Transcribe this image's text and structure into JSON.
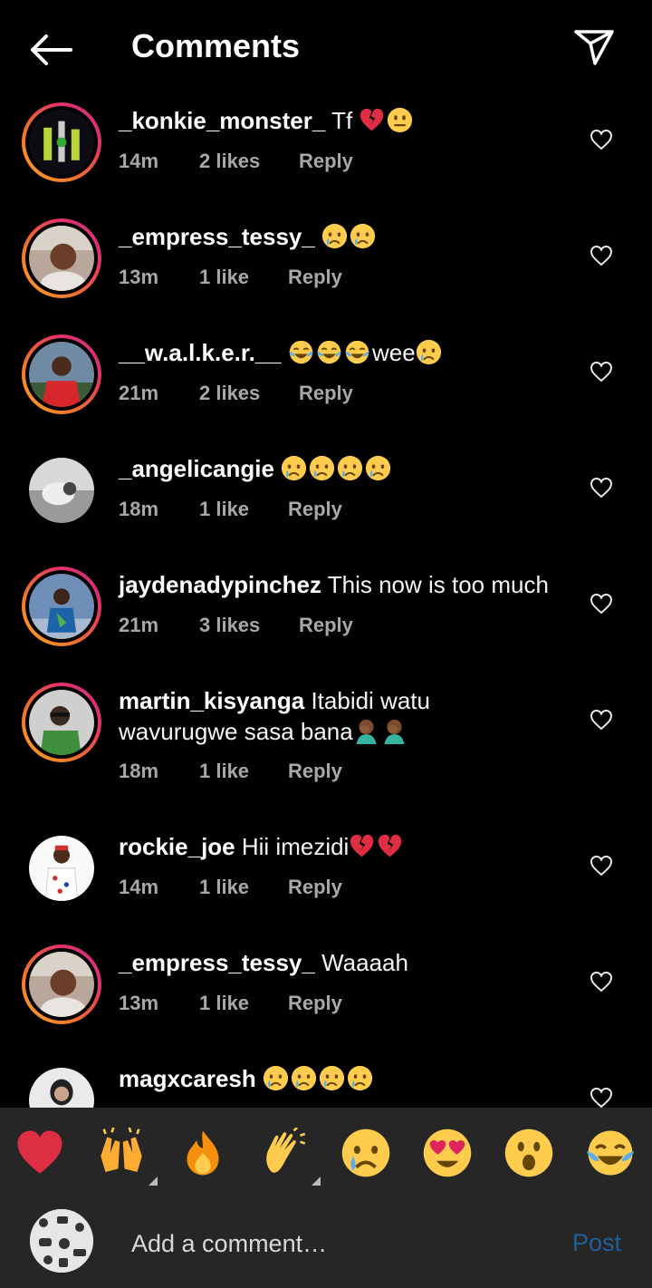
{
  "header": {
    "title": "Comments"
  },
  "comments": [
    {
      "username": "_konkie_monster_",
      "text": "Tf",
      "emojis": [
        "broken-heart",
        "neutral-face"
      ],
      "time": "14m",
      "likes": "2 likes",
      "reply": "Reply"
    },
    {
      "username": "_empress_tessy_",
      "text": "",
      "emojis": [
        "crying-face",
        "crying-face"
      ],
      "time": "13m",
      "likes": "1 like",
      "reply": "Reply"
    },
    {
      "username": "__w.a.l.k.e.r.__",
      "text": "",
      "emojis": [
        "tears-of-joy",
        "tears-of-joy",
        "tears-of-joy"
      ],
      "text_after": "wee",
      "emojis_after": [
        "crying-face"
      ],
      "time": "21m",
      "likes": "2 likes",
      "reply": "Reply"
    },
    {
      "username": "_angelicangie",
      "text": "",
      "emojis": [
        "crying-face",
        "crying-face",
        "crying-face",
        "crying-face"
      ],
      "time": "18m",
      "likes": "1 like",
      "reply": "Reply"
    },
    {
      "username": "jaydenadypinchez",
      "text": "This now is too much",
      "emojis": [],
      "time": "21m",
      "likes": "3 likes",
      "reply": "Reply"
    },
    {
      "username": "martin_kisyanga",
      "text": "Itabidi watu wavurugwe sasa bana",
      "emojis": [
        "face-palm",
        "face-palm"
      ],
      "time": "18m",
      "likes": "1 like",
      "reply": "Reply"
    },
    {
      "username": "rockie_joe",
      "text": "Hii imezidi",
      "emojis": [
        "broken-heart",
        "broken-heart"
      ],
      "time": "14m",
      "likes": "1 like",
      "reply": "Reply"
    },
    {
      "username": "_empress_tessy_",
      "text": "Waaaah",
      "emojis": [],
      "time": "13m",
      "likes": "1 like",
      "reply": "Reply"
    },
    {
      "username": "magxcaresh",
      "text": "",
      "emojis": [
        "crying-face",
        "crying-face",
        "crying-face",
        "crying-face"
      ],
      "time": "",
      "likes": "",
      "reply": ""
    }
  ],
  "reactions": [
    "red-heart",
    "raising-hands",
    "fire",
    "clapping-hands",
    "crying-face",
    "heart-eyes",
    "open-mouth-face",
    "tears-of-joy"
  ],
  "composer": {
    "placeholder": "Add a comment…",
    "post_label": "Post"
  },
  "colors": {
    "background": "#000000",
    "bar": "#262626",
    "muted": "#a8a8a8",
    "post": "#1f5f9a",
    "story_ring": "#e1306c"
  }
}
